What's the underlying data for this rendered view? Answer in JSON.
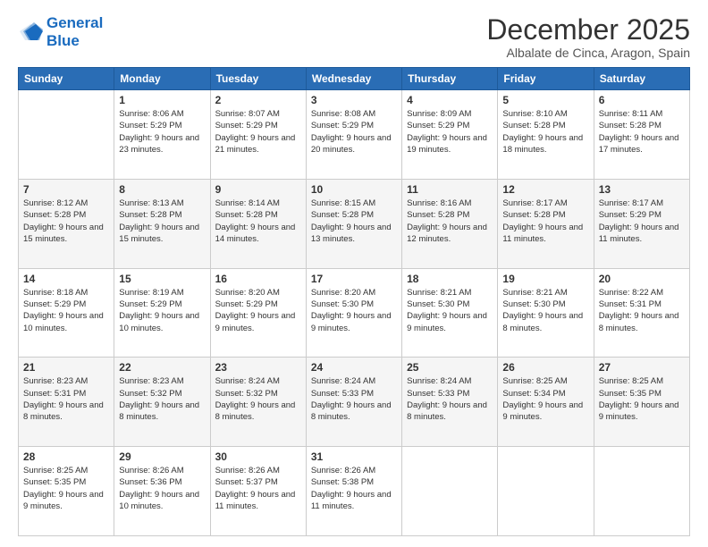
{
  "logo": {
    "line1": "General",
    "line2": "Blue"
  },
  "header": {
    "month": "December 2025",
    "location": "Albalate de Cinca, Aragon, Spain"
  },
  "weekdays": [
    "Sunday",
    "Monday",
    "Tuesday",
    "Wednesday",
    "Thursday",
    "Friday",
    "Saturday"
  ],
  "weeks": [
    [
      {
        "day": "",
        "info": ""
      },
      {
        "day": "1",
        "info": "Sunrise: 8:06 AM\nSunset: 5:29 PM\nDaylight: 9 hours\nand 23 minutes."
      },
      {
        "day": "2",
        "info": "Sunrise: 8:07 AM\nSunset: 5:29 PM\nDaylight: 9 hours\nand 21 minutes."
      },
      {
        "day": "3",
        "info": "Sunrise: 8:08 AM\nSunset: 5:29 PM\nDaylight: 9 hours\nand 20 minutes."
      },
      {
        "day": "4",
        "info": "Sunrise: 8:09 AM\nSunset: 5:29 PM\nDaylight: 9 hours\nand 19 minutes."
      },
      {
        "day": "5",
        "info": "Sunrise: 8:10 AM\nSunset: 5:28 PM\nDaylight: 9 hours\nand 18 minutes."
      },
      {
        "day": "6",
        "info": "Sunrise: 8:11 AM\nSunset: 5:28 PM\nDaylight: 9 hours\nand 17 minutes."
      }
    ],
    [
      {
        "day": "7",
        "info": "Sunrise: 8:12 AM\nSunset: 5:28 PM\nDaylight: 9 hours\nand 15 minutes."
      },
      {
        "day": "8",
        "info": "Sunrise: 8:13 AM\nSunset: 5:28 PM\nDaylight: 9 hours\nand 15 minutes."
      },
      {
        "day": "9",
        "info": "Sunrise: 8:14 AM\nSunset: 5:28 PM\nDaylight: 9 hours\nand 14 minutes."
      },
      {
        "day": "10",
        "info": "Sunrise: 8:15 AM\nSunset: 5:28 PM\nDaylight: 9 hours\nand 13 minutes."
      },
      {
        "day": "11",
        "info": "Sunrise: 8:16 AM\nSunset: 5:28 PM\nDaylight: 9 hours\nand 12 minutes."
      },
      {
        "day": "12",
        "info": "Sunrise: 8:17 AM\nSunset: 5:28 PM\nDaylight: 9 hours\nand 11 minutes."
      },
      {
        "day": "13",
        "info": "Sunrise: 8:17 AM\nSunset: 5:29 PM\nDaylight: 9 hours\nand 11 minutes."
      }
    ],
    [
      {
        "day": "14",
        "info": "Sunrise: 8:18 AM\nSunset: 5:29 PM\nDaylight: 9 hours\nand 10 minutes."
      },
      {
        "day": "15",
        "info": "Sunrise: 8:19 AM\nSunset: 5:29 PM\nDaylight: 9 hours\nand 10 minutes."
      },
      {
        "day": "16",
        "info": "Sunrise: 8:20 AM\nSunset: 5:29 PM\nDaylight: 9 hours\nand 9 minutes."
      },
      {
        "day": "17",
        "info": "Sunrise: 8:20 AM\nSunset: 5:30 PM\nDaylight: 9 hours\nand 9 minutes."
      },
      {
        "day": "18",
        "info": "Sunrise: 8:21 AM\nSunset: 5:30 PM\nDaylight: 9 hours\nand 9 minutes."
      },
      {
        "day": "19",
        "info": "Sunrise: 8:21 AM\nSunset: 5:30 PM\nDaylight: 9 hours\nand 8 minutes."
      },
      {
        "day": "20",
        "info": "Sunrise: 8:22 AM\nSunset: 5:31 PM\nDaylight: 9 hours\nand 8 minutes."
      }
    ],
    [
      {
        "day": "21",
        "info": "Sunrise: 8:23 AM\nSunset: 5:31 PM\nDaylight: 9 hours\nand 8 minutes."
      },
      {
        "day": "22",
        "info": "Sunrise: 8:23 AM\nSunset: 5:32 PM\nDaylight: 9 hours\nand 8 minutes."
      },
      {
        "day": "23",
        "info": "Sunrise: 8:24 AM\nSunset: 5:32 PM\nDaylight: 9 hours\nand 8 minutes."
      },
      {
        "day": "24",
        "info": "Sunrise: 8:24 AM\nSunset: 5:33 PM\nDaylight: 9 hours\nand 8 minutes."
      },
      {
        "day": "25",
        "info": "Sunrise: 8:24 AM\nSunset: 5:33 PM\nDaylight: 9 hours\nand 8 minutes."
      },
      {
        "day": "26",
        "info": "Sunrise: 8:25 AM\nSunset: 5:34 PM\nDaylight: 9 hours\nand 9 minutes."
      },
      {
        "day": "27",
        "info": "Sunrise: 8:25 AM\nSunset: 5:35 PM\nDaylight: 9 hours\nand 9 minutes."
      }
    ],
    [
      {
        "day": "28",
        "info": "Sunrise: 8:25 AM\nSunset: 5:35 PM\nDaylight: 9 hours\nand 9 minutes."
      },
      {
        "day": "29",
        "info": "Sunrise: 8:26 AM\nSunset: 5:36 PM\nDaylight: 9 hours\nand 10 minutes."
      },
      {
        "day": "30",
        "info": "Sunrise: 8:26 AM\nSunset: 5:37 PM\nDaylight: 9 hours\nand 11 minutes."
      },
      {
        "day": "31",
        "info": "Sunrise: 8:26 AM\nSunset: 5:38 PM\nDaylight: 9 hours\nand 11 minutes."
      },
      {
        "day": "",
        "info": ""
      },
      {
        "day": "",
        "info": ""
      },
      {
        "day": "",
        "info": ""
      }
    ]
  ]
}
